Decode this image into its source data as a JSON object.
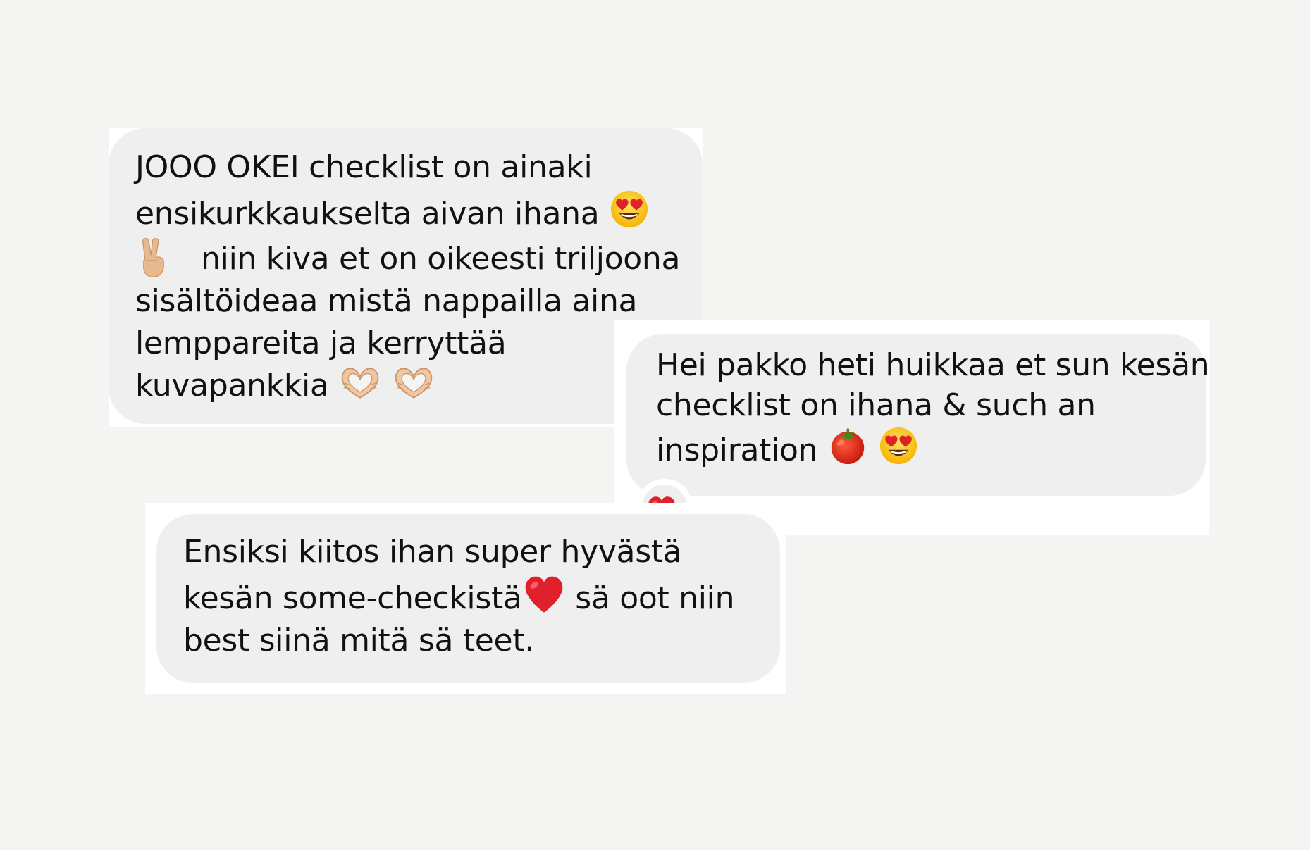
{
  "messages": [
    {
      "id": "message-1",
      "lines": [
        {
          "text": "JOOO OKEI checklist on ainaki"
        },
        {
          "text": "ensikurkkaukselta aivan ihana",
          "emoji_after": "heart-eyes-emoji"
        },
        {
          "emoji_before": "victory-hand-emoji",
          "text": "niin kiva et on oikeesti triljoona"
        },
        {
          "text": "sisältöideaa mistä nappailla aina"
        },
        {
          "text": "lemppareita ja kerryttää"
        },
        {
          "text": "kuvapankkia",
          "emoji_after": [
            "heart-hands-emoji",
            "heart-hands-emoji"
          ]
        }
      ]
    },
    {
      "id": "message-2",
      "lines": [
        {
          "text": "Hei pakko heti huikkaa et sun kesän"
        },
        {
          "text": "checklist on ihana & such an"
        },
        {
          "text": "inspiration",
          "emoji_after": [
            "tomato-emoji",
            "heart-eyes-emoji"
          ]
        }
      ],
      "reaction": "red-heart-emoji"
    },
    {
      "id": "message-3",
      "lines": [
        {
          "text": "Ensiksi kiitos ihan super hyvästä"
        },
        {
          "text": "kesän some-checkistä",
          "emoji_after": "red-heart-emoji",
          "text_after": "sä oot niin"
        },
        {
          "text": "best siinä mitä sä teet."
        }
      ]
    }
  ],
  "colors": {
    "background": "#f4f4f2",
    "card": "#ffffff",
    "bubble": "#efefef",
    "text": "#111111",
    "heart_red": "#e0202b"
  }
}
